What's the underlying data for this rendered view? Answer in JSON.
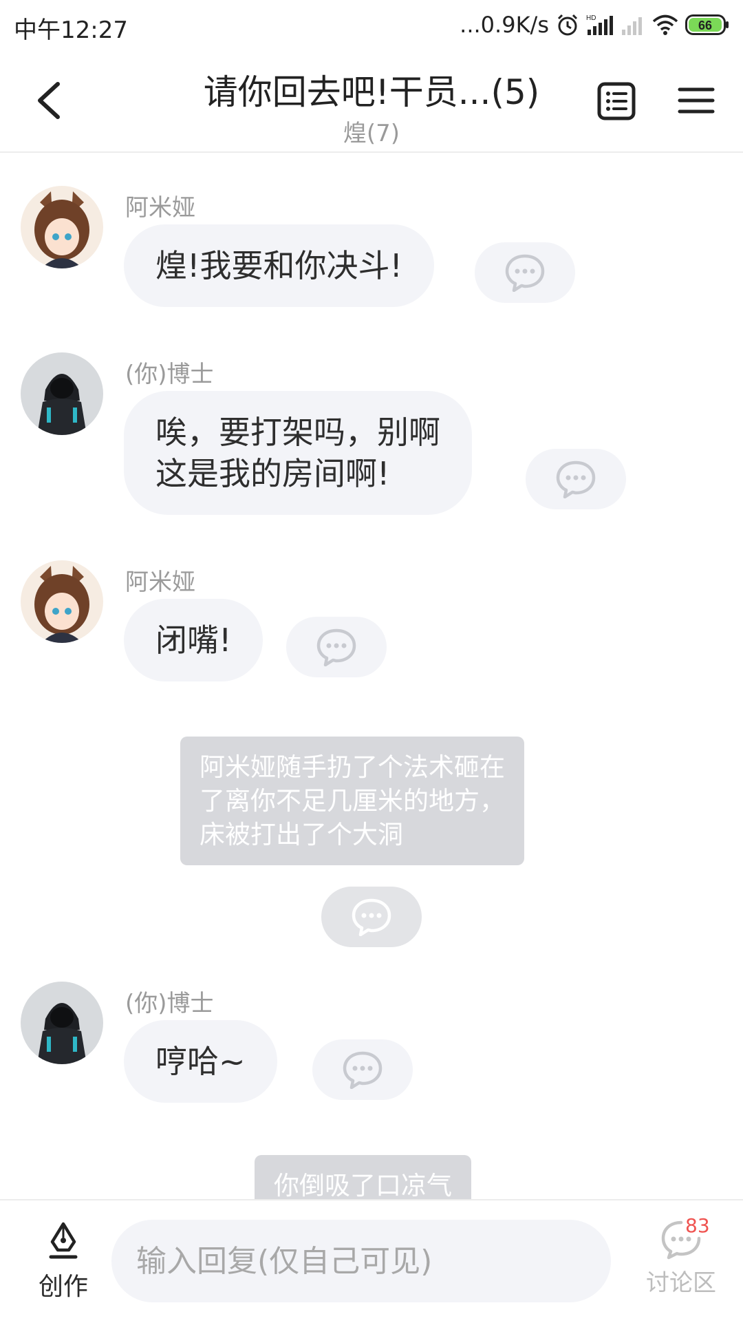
{
  "status_bar": {
    "time": "中午12:27",
    "network_speed": "...0.9K/s",
    "battery_level": "66",
    "icons": [
      "alarm-icon",
      "hd-signal-icon",
      "signal-icon",
      "wifi-icon",
      "battery-icon"
    ]
  },
  "header": {
    "title": "请你回去吧!干员...(5)",
    "subtitle": "煌(7)",
    "icons": [
      "back-icon",
      "catalog-icon",
      "menu-icon"
    ]
  },
  "messages": [
    {
      "type": "char",
      "name": "阿米娅",
      "text": "煌!我要和你决斗!"
    },
    {
      "type": "char",
      "name": "(你)博士",
      "lines": [
        "唉，要打架吗，别啊",
        "这是我的房间啊!"
      ]
    },
    {
      "type": "char",
      "name": "阿米娅",
      "text": "闭嘴!"
    },
    {
      "type": "narration",
      "lines": [
        "阿米娅随手扔了个法术砸在",
        "了离你不足几厘米的地方，",
        "床被打出了个大洞"
      ]
    },
    {
      "type": "char",
      "name": "(你)博士",
      "text": "哼哈~"
    },
    {
      "type": "narration",
      "text": "你倒吸了口凉气"
    }
  ],
  "bottom_bar": {
    "create_label": "创作",
    "input_placeholder": "输入回复(仅自己可见)",
    "discuss_label": "讨论区",
    "discuss_badge": "83"
  },
  "colors": {
    "bubble_bg": "#f3f4f8",
    "narration_bg": "#d7d8dc",
    "badge": "#ef5350",
    "battery_fill": "#7bd957"
  }
}
